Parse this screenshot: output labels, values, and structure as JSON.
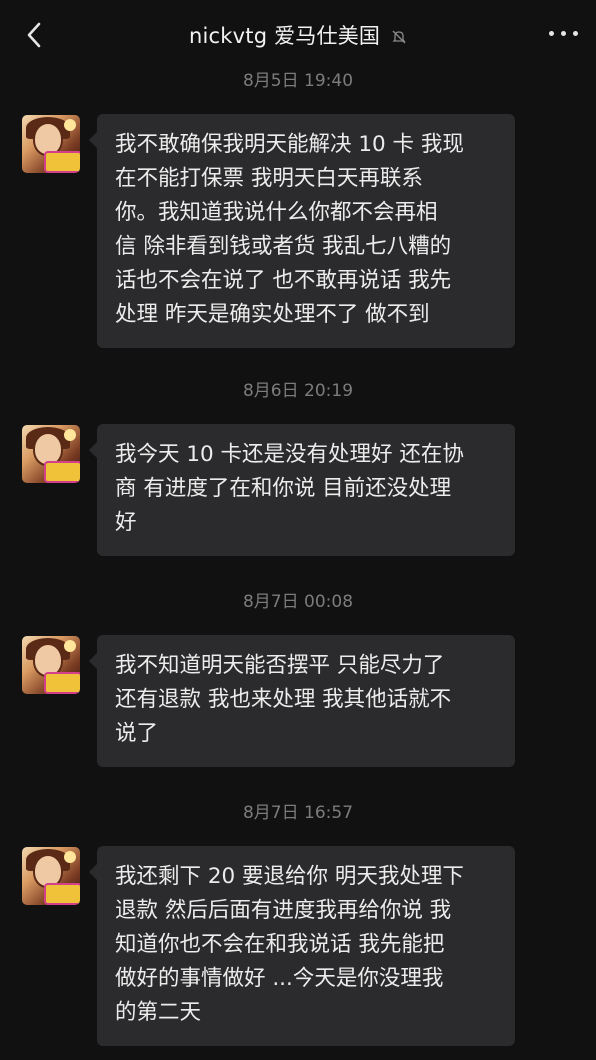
{
  "header": {
    "back_icon": "chevron-left-icon",
    "title": "nickvtg 爱马仕美国",
    "mute_icon": "bell-muted-icon",
    "more_icon": "more-dots-icon"
  },
  "messages": [
    {
      "timestamp": "8月5日 19:40",
      "lines": [
        "我不敢确保我明天能解决 10 卡 我现",
        "在不能打保票 我明天白天再联系",
        "你。我知道我说什么你都不会再相",
        "信 除非看到钱或者货 我乱七八糟的",
        "话也不会在说了 也不敢再说话 我先",
        "处理 昨天是确实处理不了 做不到"
      ]
    },
    {
      "timestamp": "8月6日 20:19",
      "lines": [
        "我今天 10 卡还是没有处理好 还在协",
        "商 有进度了在和你说 目前还没处理",
        "好"
      ]
    },
    {
      "timestamp": "8月7日 00:08",
      "lines": [
        "我不知道明天能否摆平 只能尽力了",
        "还有退款 我也来处理 我其他话就不",
        "说了"
      ]
    },
    {
      "timestamp": "8月7日 16:57",
      "lines": [
        "我还剩下 20 要退给你 明天我处理下",
        "退款 然后后面有进度我再给你说 我",
        "知道你也不会在和我说话 我先能把",
        "做好的事情做好 ...今天是你没理我",
        "的第二天"
      ]
    }
  ]
}
